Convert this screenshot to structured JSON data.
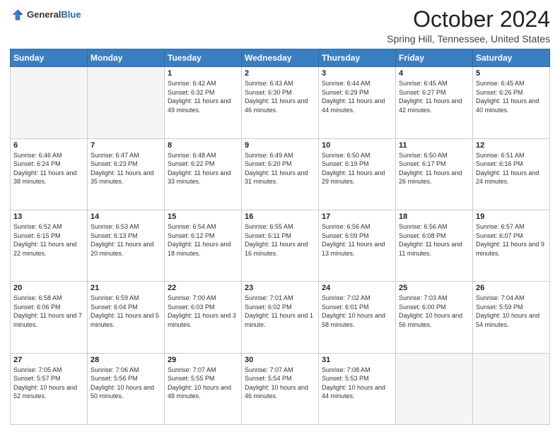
{
  "header": {
    "logo_general": "General",
    "logo_blue": "Blue",
    "month_title": "October 2024",
    "location": "Spring Hill, Tennessee, United States"
  },
  "days_of_week": [
    "Sunday",
    "Monday",
    "Tuesday",
    "Wednesday",
    "Thursday",
    "Friday",
    "Saturday"
  ],
  "weeks": [
    [
      {
        "day": "",
        "sunrise": "",
        "sunset": "",
        "daylight": ""
      },
      {
        "day": "",
        "sunrise": "",
        "sunset": "",
        "daylight": ""
      },
      {
        "day": "1",
        "sunrise": "Sunrise: 6:42 AM",
        "sunset": "Sunset: 6:32 PM",
        "daylight": "Daylight: 11 hours and 49 minutes."
      },
      {
        "day": "2",
        "sunrise": "Sunrise: 6:43 AM",
        "sunset": "Sunset: 6:30 PM",
        "daylight": "Daylight: 11 hours and 46 minutes."
      },
      {
        "day": "3",
        "sunrise": "Sunrise: 6:44 AM",
        "sunset": "Sunset: 6:29 PM",
        "daylight": "Daylight: 11 hours and 44 minutes."
      },
      {
        "day": "4",
        "sunrise": "Sunrise: 6:45 AM",
        "sunset": "Sunset: 6:27 PM",
        "daylight": "Daylight: 11 hours and 42 minutes."
      },
      {
        "day": "5",
        "sunrise": "Sunrise: 6:45 AM",
        "sunset": "Sunset: 6:26 PM",
        "daylight": "Daylight: 11 hours and 40 minutes."
      }
    ],
    [
      {
        "day": "6",
        "sunrise": "Sunrise: 6:46 AM",
        "sunset": "Sunset: 6:24 PM",
        "daylight": "Daylight: 11 hours and 38 minutes."
      },
      {
        "day": "7",
        "sunrise": "Sunrise: 6:47 AM",
        "sunset": "Sunset: 6:23 PM",
        "daylight": "Daylight: 11 hours and 35 minutes."
      },
      {
        "day": "8",
        "sunrise": "Sunrise: 6:48 AM",
        "sunset": "Sunset: 6:22 PM",
        "daylight": "Daylight: 11 hours and 33 minutes."
      },
      {
        "day": "9",
        "sunrise": "Sunrise: 6:49 AM",
        "sunset": "Sunset: 6:20 PM",
        "daylight": "Daylight: 11 hours and 31 minutes."
      },
      {
        "day": "10",
        "sunrise": "Sunrise: 6:50 AM",
        "sunset": "Sunset: 6:19 PM",
        "daylight": "Daylight: 11 hours and 29 minutes."
      },
      {
        "day": "11",
        "sunrise": "Sunrise: 6:50 AM",
        "sunset": "Sunset: 6:17 PM",
        "daylight": "Daylight: 11 hours and 26 minutes."
      },
      {
        "day": "12",
        "sunrise": "Sunrise: 6:51 AM",
        "sunset": "Sunset: 6:16 PM",
        "daylight": "Daylight: 11 hours and 24 minutes."
      }
    ],
    [
      {
        "day": "13",
        "sunrise": "Sunrise: 6:52 AM",
        "sunset": "Sunset: 6:15 PM",
        "daylight": "Daylight: 11 hours and 22 minutes."
      },
      {
        "day": "14",
        "sunrise": "Sunrise: 6:53 AM",
        "sunset": "Sunset: 6:13 PM",
        "daylight": "Daylight: 11 hours and 20 minutes."
      },
      {
        "day": "15",
        "sunrise": "Sunrise: 6:54 AM",
        "sunset": "Sunset: 6:12 PM",
        "daylight": "Daylight: 11 hours and 18 minutes."
      },
      {
        "day": "16",
        "sunrise": "Sunrise: 6:55 AM",
        "sunset": "Sunset: 6:11 PM",
        "daylight": "Daylight: 11 hours and 16 minutes."
      },
      {
        "day": "17",
        "sunrise": "Sunrise: 6:56 AM",
        "sunset": "Sunset: 6:09 PM",
        "daylight": "Daylight: 11 hours and 13 minutes."
      },
      {
        "day": "18",
        "sunrise": "Sunrise: 6:56 AM",
        "sunset": "Sunset: 6:08 PM",
        "daylight": "Daylight: 11 hours and 11 minutes."
      },
      {
        "day": "19",
        "sunrise": "Sunrise: 6:57 AM",
        "sunset": "Sunset: 6:07 PM",
        "daylight": "Daylight: 11 hours and 9 minutes."
      }
    ],
    [
      {
        "day": "20",
        "sunrise": "Sunrise: 6:58 AM",
        "sunset": "Sunset: 6:06 PM",
        "daylight": "Daylight: 11 hours and 7 minutes."
      },
      {
        "day": "21",
        "sunrise": "Sunrise: 6:59 AM",
        "sunset": "Sunset: 6:04 PM",
        "daylight": "Daylight: 11 hours and 5 minutes."
      },
      {
        "day": "22",
        "sunrise": "Sunrise: 7:00 AM",
        "sunset": "Sunset: 6:03 PM",
        "daylight": "Daylight: 11 hours and 3 minutes."
      },
      {
        "day": "23",
        "sunrise": "Sunrise: 7:01 AM",
        "sunset": "Sunset: 6:02 PM",
        "daylight": "Daylight: 11 hours and 1 minute."
      },
      {
        "day": "24",
        "sunrise": "Sunrise: 7:02 AM",
        "sunset": "Sunset: 6:01 PM",
        "daylight": "Daylight: 10 hours and 58 minutes."
      },
      {
        "day": "25",
        "sunrise": "Sunrise: 7:03 AM",
        "sunset": "Sunset: 6:00 PM",
        "daylight": "Daylight: 10 hours and 56 minutes."
      },
      {
        "day": "26",
        "sunrise": "Sunrise: 7:04 AM",
        "sunset": "Sunset: 5:59 PM",
        "daylight": "Daylight: 10 hours and 54 minutes."
      }
    ],
    [
      {
        "day": "27",
        "sunrise": "Sunrise: 7:05 AM",
        "sunset": "Sunset: 5:57 PM",
        "daylight": "Daylight: 10 hours and 52 minutes."
      },
      {
        "day": "28",
        "sunrise": "Sunrise: 7:06 AM",
        "sunset": "Sunset: 5:56 PM",
        "daylight": "Daylight: 10 hours and 50 minutes."
      },
      {
        "day": "29",
        "sunrise": "Sunrise: 7:07 AM",
        "sunset": "Sunset: 5:55 PM",
        "daylight": "Daylight: 10 hours and 48 minutes."
      },
      {
        "day": "30",
        "sunrise": "Sunrise: 7:07 AM",
        "sunset": "Sunset: 5:54 PM",
        "daylight": "Daylight: 10 hours and 46 minutes."
      },
      {
        "day": "31",
        "sunrise": "Sunrise: 7:08 AM",
        "sunset": "Sunset: 5:53 PM",
        "daylight": "Daylight: 10 hours and 44 minutes."
      },
      {
        "day": "",
        "sunrise": "",
        "sunset": "",
        "daylight": ""
      },
      {
        "day": "",
        "sunrise": "",
        "sunset": "",
        "daylight": ""
      }
    ]
  ]
}
